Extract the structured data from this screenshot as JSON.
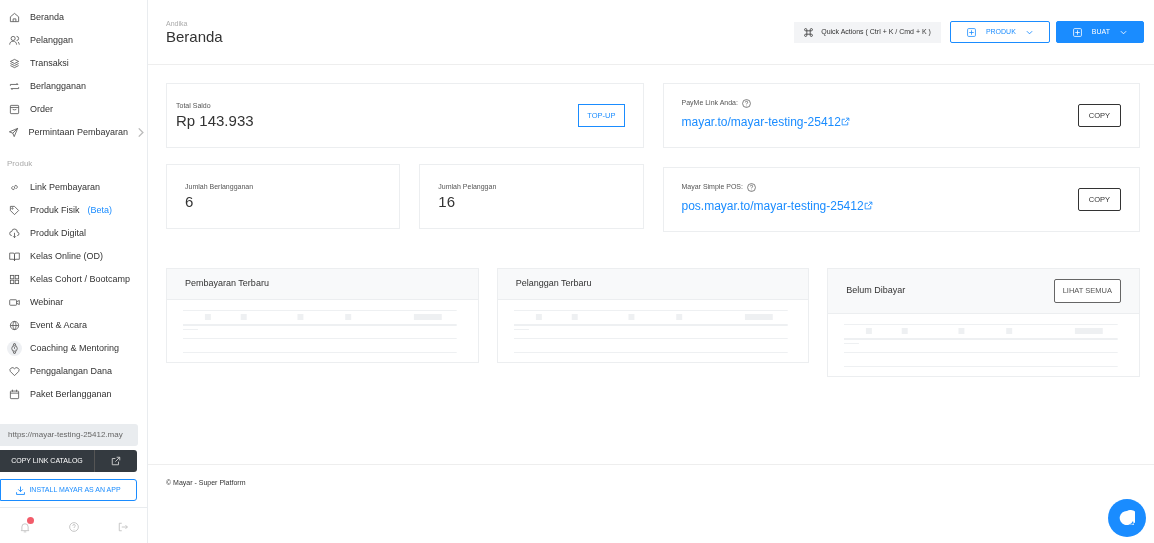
{
  "sidebar": {
    "menu": [
      {
        "kind": "item",
        "label": "Beranda",
        "highlighted": false
      },
      {
        "kind": "item",
        "label": "Pelanggan",
        "highlighted": false
      },
      {
        "kind": "item",
        "label": "Transaksi",
        "highlighted": false
      },
      {
        "kind": "item",
        "label": "Berlangganan",
        "highlighted": false
      },
      {
        "kind": "item",
        "label": "Order",
        "highlighted": false
      },
      {
        "kind": "item",
        "label": "Permintaan Pembayaran",
        "highlighted": false,
        "submenu": true
      },
      {
        "kind": "heading",
        "label": "Produk"
      },
      {
        "kind": "item",
        "label": "Link Pembayaran",
        "highlighted": false
      },
      {
        "kind": "item",
        "label": "Produk Fisik",
        "highlighted": false,
        "tag": "(Beta)"
      },
      {
        "kind": "item",
        "label": "Produk Digital",
        "highlighted": false
      },
      {
        "kind": "item",
        "label": "Kelas Online (OD)",
        "highlighted": false
      },
      {
        "kind": "item",
        "label": "Kelas Cohort / Bootcamp",
        "highlighted": false
      },
      {
        "kind": "item",
        "label": "Webinar",
        "highlighted": false
      },
      {
        "kind": "item",
        "label": "Event & Acara",
        "highlighted": false
      },
      {
        "kind": "item",
        "label": "Coaching & Mentoring",
        "highlighted": true
      },
      {
        "kind": "item",
        "label": "Penggalangan Dana",
        "highlighted": false
      },
      {
        "kind": "item",
        "label": "Paket Berlangganan",
        "highlighted": false
      }
    ],
    "catalog_url": "https://mayar-testing-25412.may",
    "copy_catalog": "COPY LINK CATALOG",
    "install": "INSTALL MAYAR AS AN APP"
  },
  "header": {
    "user": "Andika",
    "title": "Beranda",
    "quick_actions": "Quick Actions ( Ctrl + K / Cmd + K )",
    "buttons": [
      {
        "label": "PRODUK",
        "kind": "outline"
      },
      {
        "label": "BUAT",
        "kind": "primary"
      }
    ]
  },
  "balance": {
    "label": "Total Saldo",
    "value": "Rp 143.933",
    "button": "TOP-UP"
  },
  "stats": [
    {
      "label": "Jumlah Berlangganan",
      "value": "6"
    },
    {
      "label": "Jumlah Pelanggan",
      "value": "16"
    }
  ],
  "links": [
    {
      "label": "PayMe Link Anda:",
      "url": "mayar.to/mayar-testing-25412",
      "button": "COPY"
    },
    {
      "label": "Mayar Simple POS:",
      "url": "pos.mayar.to/mayar-testing-25412",
      "button": "COPY"
    }
  ],
  "panels": [
    {
      "title": "Pembayaran Terbaru"
    },
    {
      "title": "Pelanggan Terbaru"
    },
    {
      "title": "Belum Dibayar",
      "button": "LIHAT SEMUA"
    }
  ],
  "footer": "© Mayar - Super Platform"
}
